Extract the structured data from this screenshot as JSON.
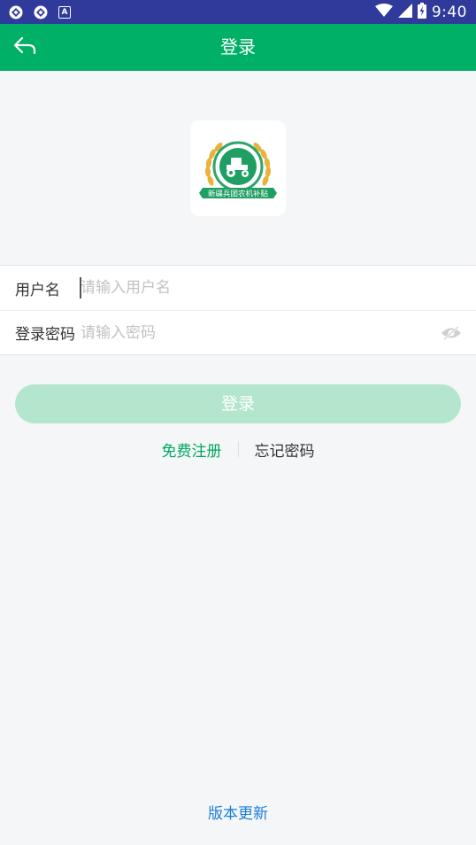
{
  "status_bar": {
    "time": "9:40",
    "icons": [
      "sync-icon",
      "sync-icon",
      "a-notification-icon",
      "wifi-icon",
      "signal-icon",
      "battery-charging-icon"
    ]
  },
  "app_bar": {
    "title": "登录",
    "back_icon": "back-arrow-icon"
  },
  "logo": {
    "text": "新疆兵团农机补贴"
  },
  "form": {
    "username": {
      "label": "用户名",
      "value": "",
      "placeholder": "请输入用户名"
    },
    "password": {
      "label": "登录密码",
      "value": "",
      "placeholder": "请输入密码",
      "toggle_icon": "eye-hidden-icon"
    }
  },
  "login_button": {
    "label": "登录"
  },
  "links": {
    "register": "免费注册",
    "forgot": "忘记密码"
  },
  "footer": {
    "version_update": "版本更新"
  },
  "colors": {
    "status_bar": "#2f3a9a",
    "brand_green": "#00b067",
    "button_disabled": "#b3e6cd",
    "link_green": "#00a85f",
    "link_blue": "#1a7fd6",
    "background": "#f5f6f8"
  }
}
